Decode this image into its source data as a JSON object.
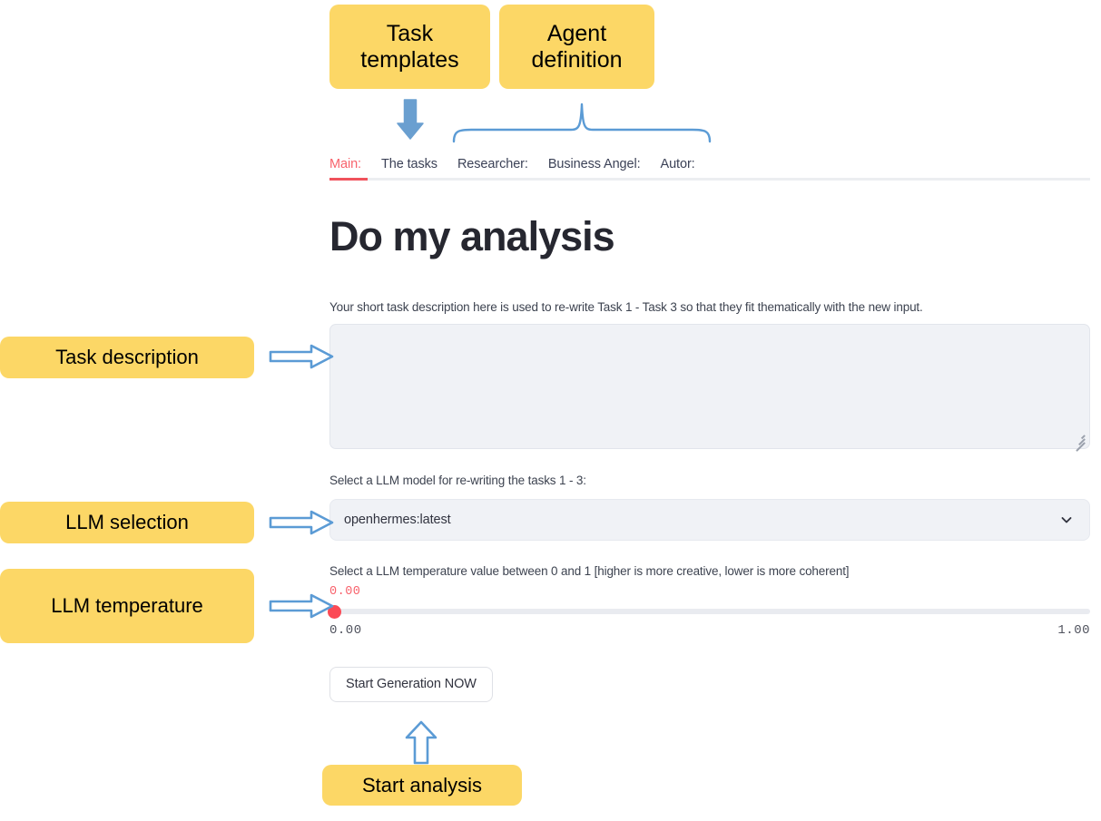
{
  "app": {
    "tabs": [
      {
        "label": "Main:",
        "active": true
      },
      {
        "label": "The tasks",
        "active": false
      },
      {
        "label": "Researcher:",
        "active": false
      },
      {
        "label": "Business Angel:",
        "active": false
      },
      {
        "label": "Autor:",
        "active": false
      }
    ],
    "page_title": "Do my analysis",
    "task_description": {
      "label": "Your short task description here is used to re-write Task 1 - Task 3 so that they fit thematically with the new input.",
      "value": "",
      "placeholder": ""
    },
    "model_select": {
      "label": "Select a LLM model for re-writing the tasks 1 - 3:",
      "value": "openhermes:latest",
      "chevron_icon": "chevron-down-icon"
    },
    "temperature": {
      "label": "Select a LLM temperature value between 0 and 1 [higher is more creative, lower is more coherent]",
      "value": "0.00",
      "min_label": "0.00",
      "max_label": "1.00",
      "fill_percent": 0
    },
    "start_button": {
      "label": "Start Generation NOW"
    }
  },
  "annotations": {
    "task_templates": "Task\ntemplates",
    "task_templates_line1": "Task",
    "task_templates_line2": "templates",
    "agent_definition_line1": "Agent",
    "agent_definition_line2": "definition",
    "task_description": "Task description",
    "llm_selection": "LLM selection",
    "llm_temperature": "LLM temperature",
    "start_analysis": "Start analysis"
  },
  "colors": {
    "annotation_yellow": "#fcd766",
    "annotation_blue": "#5b9bd5",
    "accent_red": "#f8626c",
    "field_background": "#f0f2f6",
    "text_dark": "#31333f"
  }
}
